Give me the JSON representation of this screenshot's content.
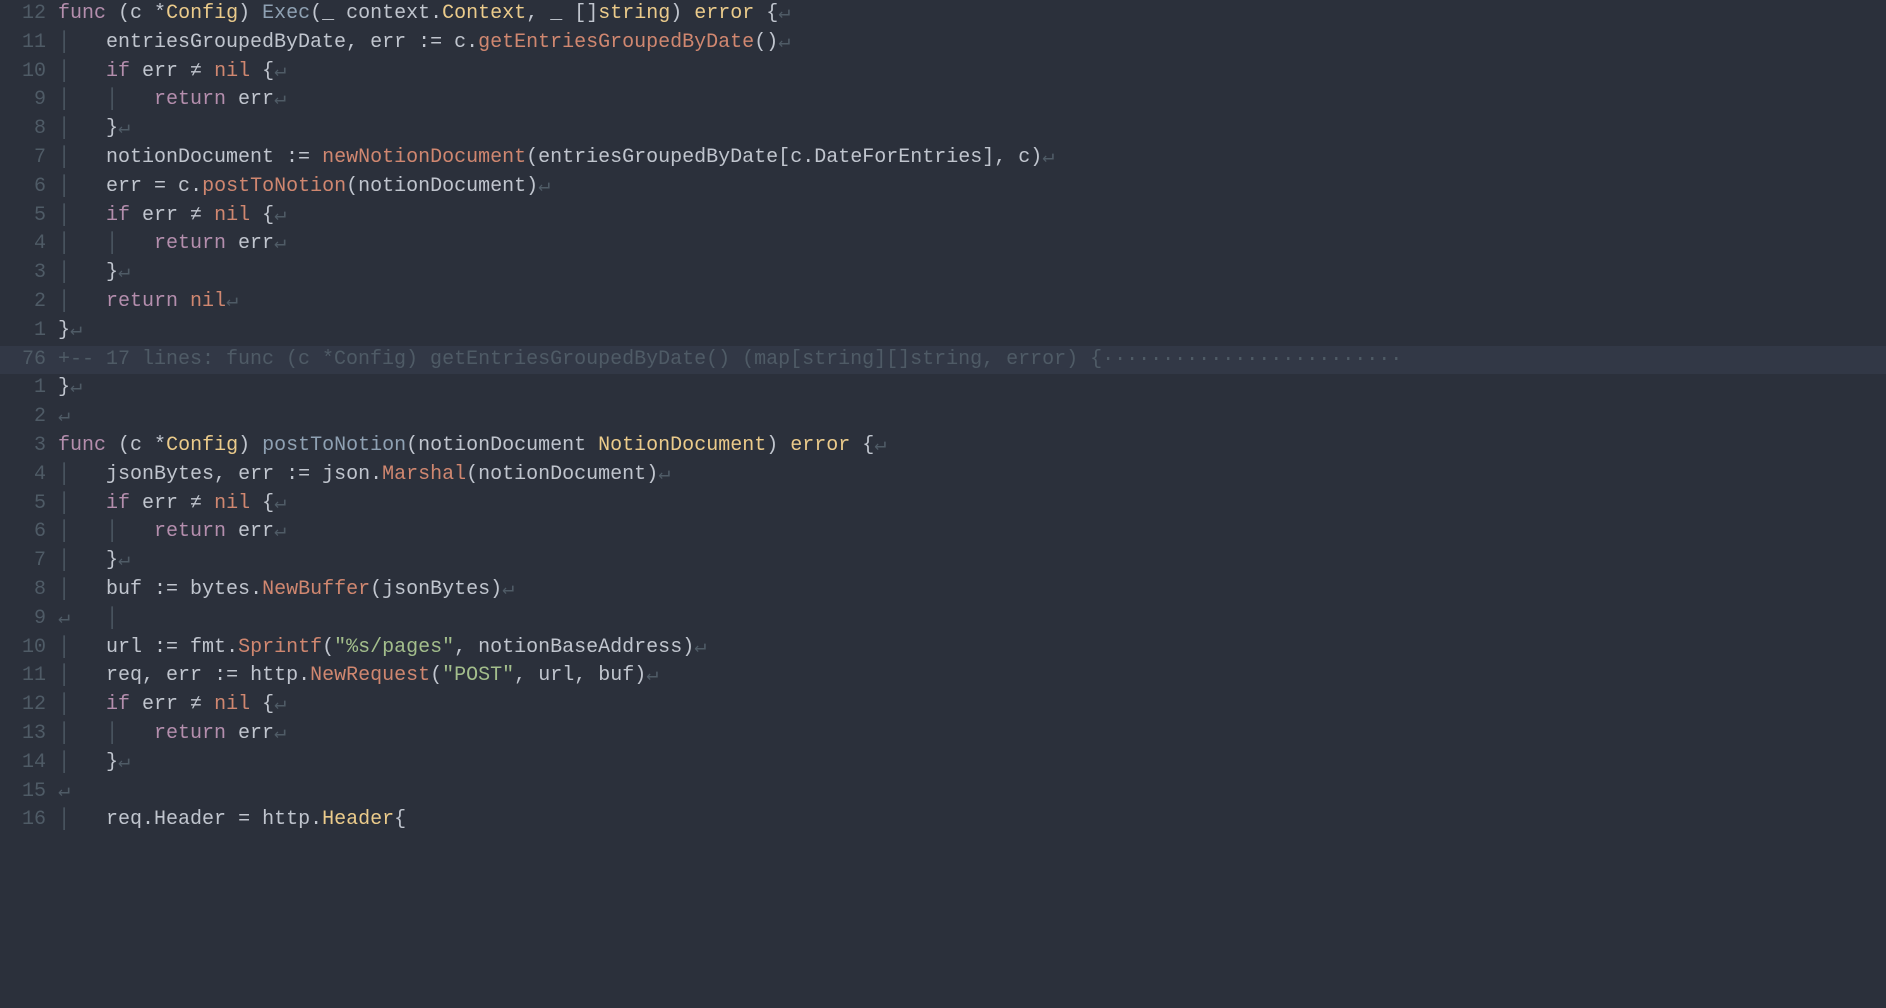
{
  "lines": [
    {
      "num": "12",
      "fold": false,
      "tokens": [
        {
          "t": "func ",
          "c": "kw"
        },
        {
          "t": "(",
          "c": "punc"
        },
        {
          "t": "c ",
          "c": "ident"
        },
        {
          "t": "*",
          "c": "op"
        },
        {
          "t": "Config",
          "c": "type"
        },
        {
          "t": ") ",
          "c": "punc"
        },
        {
          "t": "Exec",
          "c": "fn"
        },
        {
          "t": "(",
          "c": "punc"
        },
        {
          "t": "_ ",
          "c": "ident"
        },
        {
          "t": "context",
          "c": "ident"
        },
        {
          "t": ".",
          "c": "punc"
        },
        {
          "t": "Context",
          "c": "type"
        },
        {
          "t": ", ",
          "c": "punc"
        },
        {
          "t": "_ ",
          "c": "ident"
        },
        {
          "t": "[]",
          "c": "punc"
        },
        {
          "t": "string",
          "c": "type"
        },
        {
          "t": ") ",
          "c": "punc"
        },
        {
          "t": "error",
          "c": "type"
        },
        {
          "t": " {",
          "c": "punc"
        },
        {
          "t": "↵",
          "c": "eol"
        }
      ]
    },
    {
      "num": "11",
      "fold": false,
      "tokens": [
        {
          "t": "│   ",
          "c": "guide"
        },
        {
          "t": "entriesGroupedByDate",
          "c": "ident"
        },
        {
          "t": ", ",
          "c": "punc"
        },
        {
          "t": "err",
          "c": "ident"
        },
        {
          "t": " := ",
          "c": "op"
        },
        {
          "t": "c",
          "c": "ident"
        },
        {
          "t": ".",
          "c": "punc"
        },
        {
          "t": "getEntriesGroupedByDate",
          "c": "cfn"
        },
        {
          "t": "()",
          "c": "punc"
        },
        {
          "t": "↵",
          "c": "eol"
        }
      ]
    },
    {
      "num": "10",
      "fold": false,
      "tokens": [
        {
          "t": "│   ",
          "c": "guide"
        },
        {
          "t": "if ",
          "c": "kw"
        },
        {
          "t": "err",
          "c": "ident"
        },
        {
          "t": " ≠ ",
          "c": "op"
        },
        {
          "t": "nil",
          "c": "builtin"
        },
        {
          "t": " {",
          "c": "punc"
        },
        {
          "t": "↵",
          "c": "eol"
        }
      ]
    },
    {
      "num": "9",
      "fold": false,
      "tokens": [
        {
          "t": "│   │   ",
          "c": "guide"
        },
        {
          "t": "return ",
          "c": "kw"
        },
        {
          "t": "err",
          "c": "ident"
        },
        {
          "t": "↵",
          "c": "eol"
        }
      ]
    },
    {
      "num": "8",
      "fold": false,
      "tokens": [
        {
          "t": "│   ",
          "c": "guide"
        },
        {
          "t": "}",
          "c": "punc"
        },
        {
          "t": "↵",
          "c": "eol"
        }
      ]
    },
    {
      "num": "7",
      "fold": false,
      "tokens": [
        {
          "t": "│   ",
          "c": "guide"
        },
        {
          "t": "notionDocument",
          "c": "ident"
        },
        {
          "t": " := ",
          "c": "op"
        },
        {
          "t": "newNotionDocument",
          "c": "cfn"
        },
        {
          "t": "(",
          "c": "punc"
        },
        {
          "t": "entriesGroupedByDate",
          "c": "ident"
        },
        {
          "t": "[",
          "c": "punc"
        },
        {
          "t": "c",
          "c": "ident"
        },
        {
          "t": ".",
          "c": "punc"
        },
        {
          "t": "DateForEntries",
          "c": "ident"
        },
        {
          "t": "], ",
          "c": "punc"
        },
        {
          "t": "c",
          "c": "ident"
        },
        {
          "t": ")",
          "c": "punc"
        },
        {
          "t": "↵",
          "c": "eol"
        }
      ]
    },
    {
      "num": "6",
      "fold": false,
      "tokens": [
        {
          "t": "│   ",
          "c": "guide"
        },
        {
          "t": "err",
          "c": "ident"
        },
        {
          "t": " = ",
          "c": "op"
        },
        {
          "t": "c",
          "c": "ident"
        },
        {
          "t": ".",
          "c": "punc"
        },
        {
          "t": "postToNotion",
          "c": "cfn"
        },
        {
          "t": "(",
          "c": "punc"
        },
        {
          "t": "notionDocument",
          "c": "ident"
        },
        {
          "t": ")",
          "c": "punc"
        },
        {
          "t": "↵",
          "c": "eol"
        }
      ]
    },
    {
      "num": "5",
      "fold": false,
      "tokens": [
        {
          "t": "│   ",
          "c": "guide"
        },
        {
          "t": "if ",
          "c": "kw"
        },
        {
          "t": "err",
          "c": "ident"
        },
        {
          "t": " ≠ ",
          "c": "op"
        },
        {
          "t": "nil",
          "c": "builtin"
        },
        {
          "t": " {",
          "c": "punc"
        },
        {
          "t": "↵",
          "c": "eol"
        }
      ]
    },
    {
      "num": "4",
      "fold": false,
      "tokens": [
        {
          "t": "│   │   ",
          "c": "guide"
        },
        {
          "t": "return ",
          "c": "kw"
        },
        {
          "t": "err",
          "c": "ident"
        },
        {
          "t": "↵",
          "c": "eol"
        }
      ]
    },
    {
      "num": "3",
      "fold": false,
      "tokens": [
        {
          "t": "│   ",
          "c": "guide"
        },
        {
          "t": "}",
          "c": "punc"
        },
        {
          "t": "↵",
          "c": "eol"
        }
      ]
    },
    {
      "num": "2",
      "fold": false,
      "tokens": [
        {
          "t": "│   ",
          "c": "guide"
        },
        {
          "t": "return ",
          "c": "kw"
        },
        {
          "t": "nil",
          "c": "builtin"
        },
        {
          "t": "↵",
          "c": "eol"
        }
      ]
    },
    {
      "num": "1",
      "fold": false,
      "tokens": [
        {
          "t": "}",
          "c": "punc"
        },
        {
          "t": "↵",
          "c": "eol"
        }
      ]
    },
    {
      "num": "76",
      "fold": true,
      "tokens": [
        {
          "t": "+-- 17 lines: func (c *Config) getEntriesGroupedByDate() (map[string][]string, error) {·························",
          "c": "fold-text"
        }
      ]
    },
    {
      "num": "1",
      "fold": false,
      "tokens": [
        {
          "t": "}",
          "c": "punc"
        },
        {
          "t": "↵",
          "c": "eol"
        }
      ]
    },
    {
      "num": "2",
      "fold": false,
      "tokens": [
        {
          "t": "↵",
          "c": "eol"
        }
      ]
    },
    {
      "num": "3",
      "fold": false,
      "tokens": [
        {
          "t": "func ",
          "c": "kw"
        },
        {
          "t": "(",
          "c": "punc"
        },
        {
          "t": "c ",
          "c": "ident"
        },
        {
          "t": "*",
          "c": "op"
        },
        {
          "t": "Config",
          "c": "type"
        },
        {
          "t": ") ",
          "c": "punc"
        },
        {
          "t": "postToNotion",
          "c": "fn"
        },
        {
          "t": "(",
          "c": "punc"
        },
        {
          "t": "notionDocument ",
          "c": "ident"
        },
        {
          "t": "NotionDocument",
          "c": "type"
        },
        {
          "t": ") ",
          "c": "punc"
        },
        {
          "t": "error",
          "c": "type"
        },
        {
          "t": " {",
          "c": "punc"
        },
        {
          "t": "↵",
          "c": "eol"
        }
      ]
    },
    {
      "num": "4",
      "fold": false,
      "tokens": [
        {
          "t": "│   ",
          "c": "guide"
        },
        {
          "t": "jsonBytes",
          "c": "ident"
        },
        {
          "t": ", ",
          "c": "punc"
        },
        {
          "t": "err",
          "c": "ident"
        },
        {
          "t": " := ",
          "c": "op"
        },
        {
          "t": "json",
          "c": "ident"
        },
        {
          "t": ".",
          "c": "punc"
        },
        {
          "t": "Marshal",
          "c": "cfn"
        },
        {
          "t": "(",
          "c": "punc"
        },
        {
          "t": "notionDocument",
          "c": "ident"
        },
        {
          "t": ")",
          "c": "punc"
        },
        {
          "t": "↵",
          "c": "eol"
        }
      ]
    },
    {
      "num": "5",
      "fold": false,
      "tokens": [
        {
          "t": "│   ",
          "c": "guide"
        },
        {
          "t": "if ",
          "c": "kw"
        },
        {
          "t": "err",
          "c": "ident"
        },
        {
          "t": " ≠ ",
          "c": "op"
        },
        {
          "t": "nil",
          "c": "builtin"
        },
        {
          "t": " {",
          "c": "punc"
        },
        {
          "t": "↵",
          "c": "eol"
        }
      ]
    },
    {
      "num": "6",
      "fold": false,
      "tokens": [
        {
          "t": "│   │   ",
          "c": "guide"
        },
        {
          "t": "return ",
          "c": "kw"
        },
        {
          "t": "err",
          "c": "ident"
        },
        {
          "t": "↵",
          "c": "eol"
        }
      ]
    },
    {
      "num": "7",
      "fold": false,
      "tokens": [
        {
          "t": "│   ",
          "c": "guide"
        },
        {
          "t": "}",
          "c": "punc"
        },
        {
          "t": "↵",
          "c": "eol"
        }
      ]
    },
    {
      "num": "8",
      "fold": false,
      "tokens": [
        {
          "t": "│   ",
          "c": "guide"
        },
        {
          "t": "buf",
          "c": "ident"
        },
        {
          "t": " := ",
          "c": "op"
        },
        {
          "t": "bytes",
          "c": "ident"
        },
        {
          "t": ".",
          "c": "punc"
        },
        {
          "t": "NewBuffer",
          "c": "cfn"
        },
        {
          "t": "(",
          "c": "punc"
        },
        {
          "t": "jsonBytes",
          "c": "ident"
        },
        {
          "t": ")",
          "c": "punc"
        },
        {
          "t": "↵",
          "c": "eol"
        }
      ]
    },
    {
      "num": "9",
      "fold": false,
      "tokens": [
        {
          "t": "↵",
          "c": "eol"
        },
        {
          "t": "   │",
          "c": "guide"
        }
      ]
    },
    {
      "num": "10",
      "fold": false,
      "tokens": [
        {
          "t": "│   ",
          "c": "guide"
        },
        {
          "t": "url",
          "c": "ident"
        },
        {
          "t": " := ",
          "c": "op"
        },
        {
          "t": "fmt",
          "c": "ident"
        },
        {
          "t": ".",
          "c": "punc"
        },
        {
          "t": "Sprintf",
          "c": "cfn"
        },
        {
          "t": "(",
          "c": "punc"
        },
        {
          "t": "\"%s/pages\"",
          "c": "str"
        },
        {
          "t": ", ",
          "c": "punc"
        },
        {
          "t": "notionBaseAddress",
          "c": "ident"
        },
        {
          "t": ")",
          "c": "punc"
        },
        {
          "t": "↵",
          "c": "eol"
        }
      ]
    },
    {
      "num": "11",
      "fold": false,
      "tokens": [
        {
          "t": "│   ",
          "c": "guide"
        },
        {
          "t": "req",
          "c": "ident"
        },
        {
          "t": ", ",
          "c": "punc"
        },
        {
          "t": "err",
          "c": "ident"
        },
        {
          "t": " := ",
          "c": "op"
        },
        {
          "t": "http",
          "c": "ident"
        },
        {
          "t": ".",
          "c": "punc"
        },
        {
          "t": "NewRequest",
          "c": "cfn"
        },
        {
          "t": "(",
          "c": "punc"
        },
        {
          "t": "\"POST\"",
          "c": "str"
        },
        {
          "t": ", ",
          "c": "punc"
        },
        {
          "t": "url",
          "c": "ident"
        },
        {
          "t": ", ",
          "c": "punc"
        },
        {
          "t": "buf",
          "c": "ident"
        },
        {
          "t": ")",
          "c": "punc"
        },
        {
          "t": "↵",
          "c": "eol"
        }
      ]
    },
    {
      "num": "12",
      "fold": false,
      "tokens": [
        {
          "t": "│   ",
          "c": "guide"
        },
        {
          "t": "if ",
          "c": "kw"
        },
        {
          "t": "err",
          "c": "ident"
        },
        {
          "t": " ≠ ",
          "c": "op"
        },
        {
          "t": "nil",
          "c": "builtin"
        },
        {
          "t": " {",
          "c": "punc"
        },
        {
          "t": "↵",
          "c": "eol"
        }
      ]
    },
    {
      "num": "13",
      "fold": false,
      "tokens": [
        {
          "t": "│   │   ",
          "c": "guide"
        },
        {
          "t": "return ",
          "c": "kw"
        },
        {
          "t": "err",
          "c": "ident"
        },
        {
          "t": "↵",
          "c": "eol"
        }
      ]
    },
    {
      "num": "14",
      "fold": false,
      "tokens": [
        {
          "t": "│   ",
          "c": "guide"
        },
        {
          "t": "}",
          "c": "punc"
        },
        {
          "t": "↵",
          "c": "eol"
        }
      ]
    },
    {
      "num": "15",
      "fold": false,
      "tokens": [
        {
          "t": "↵",
          "c": "eol"
        }
      ]
    },
    {
      "num": "16",
      "fold": false,
      "tokens": [
        {
          "t": "│   ",
          "c": "guide"
        },
        {
          "t": "req",
          "c": "ident"
        },
        {
          "t": ".",
          "c": "punc"
        },
        {
          "t": "Header",
          "c": "ident"
        },
        {
          "t": " = ",
          "c": "op"
        },
        {
          "t": "http",
          "c": "ident"
        },
        {
          "t": ".",
          "c": "punc"
        },
        {
          "t": "Header",
          "c": "type"
        },
        {
          "t": "{",
          "c": "punc"
        }
      ]
    }
  ]
}
